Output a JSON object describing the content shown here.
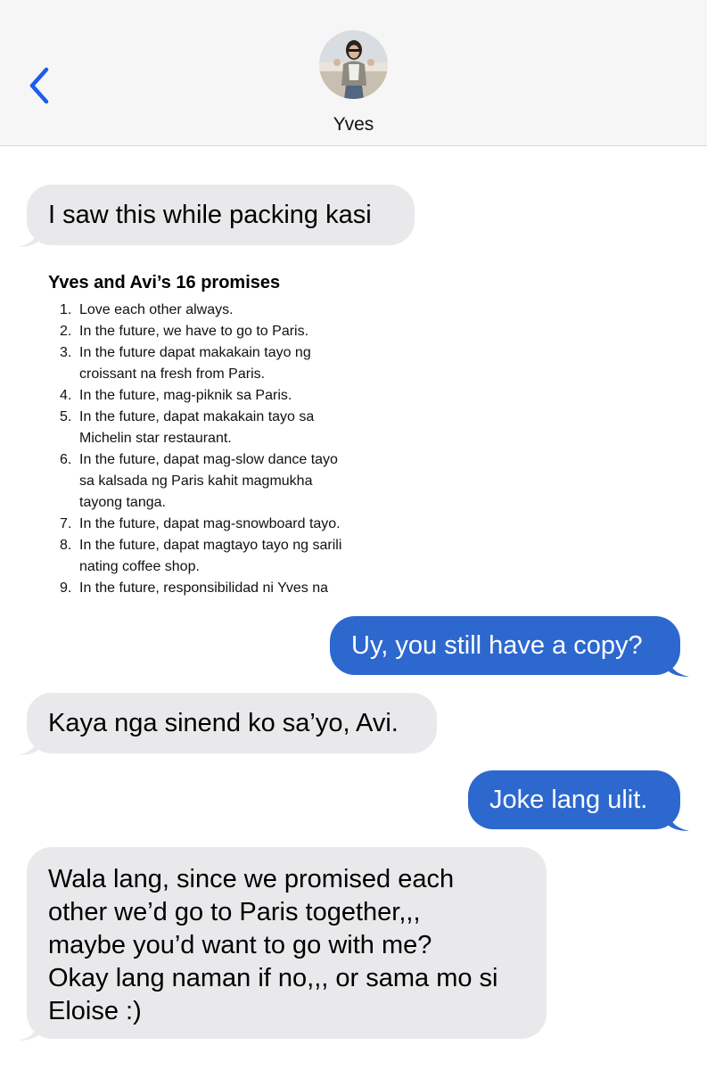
{
  "header": {
    "contact_name": "Yves",
    "back_icon": "chevron-left-icon",
    "accent_color": "#1e5cf0"
  },
  "messages": [
    {
      "side": "incoming",
      "text": "I saw this while packing kasi"
    },
    {
      "side": "outgoing",
      "text": "Uy, you still have a copy?"
    },
    {
      "side": "incoming",
      "text": "Kaya nga sinend ko sa’yo, Avi."
    },
    {
      "side": "outgoing",
      "text": "Joke lang ulit."
    },
    {
      "side": "incoming",
      "lines": [
        "Wala lang, since we promised each",
        "other we’d go to Paris together,,,",
        "maybe you’d want to go with me?",
        "Okay lang naman if no,,, or sama mo si",
        "Eloise :)"
      ]
    }
  ],
  "attachment": {
    "title": "Yves and Avi’s 16 promises",
    "items": [
      {
        "num": "1.",
        "lines": [
          "Love each other always."
        ]
      },
      {
        "num": "2.",
        "lines": [
          "In the future, we have to go to Paris."
        ]
      },
      {
        "num": "3.",
        "lines": [
          "In the future dapat makakain tayo ng",
          "croissant na fresh from Paris."
        ]
      },
      {
        "num": "4.",
        "lines": [
          "In the future, mag-piknik sa Paris."
        ]
      },
      {
        "num": "5.",
        "lines": [
          "In the future, dapat makakain tayo sa",
          "Michelin star restaurant."
        ]
      },
      {
        "num": "6.",
        "lines": [
          "In the future, dapat mag-slow dance tayo",
          "sa kalsada ng Paris kahit magmukha",
          "tayong tanga."
        ]
      },
      {
        "num": "7.",
        "lines": [
          "In the future, dapat mag-snowboard tayo."
        ]
      },
      {
        "num": "8.",
        "lines": [
          "In the future, dapat magtayo tayo ng sarili",
          "nating coffee shop."
        ]
      },
      {
        "num": "9.",
        "lines": [
          "In the future, responsibilidad ni Yves na"
        ]
      }
    ]
  },
  "colors": {
    "incoming_bubble": "#e9e9eb",
    "outgoing_bubble": "#2d68cf",
    "header_bg": "#f6f6f6"
  }
}
